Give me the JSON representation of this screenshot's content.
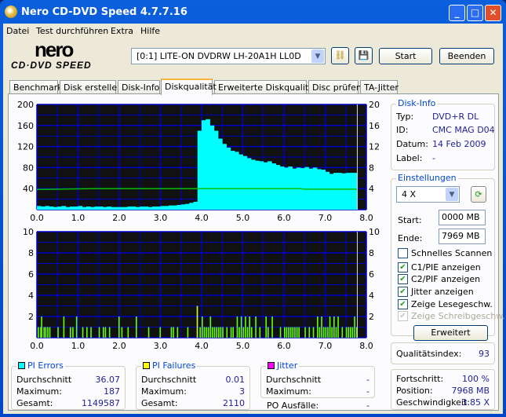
{
  "window": {
    "title": "Nero CD-DVD Speed 4.7.7.16",
    "min": "_",
    "max": "□",
    "close": "✕"
  },
  "menu": [
    "Datei",
    "Test durchführen",
    "Extra",
    "Hilfe"
  ],
  "logo": {
    "line1": "nero",
    "line2": "CD·DVD SPEED"
  },
  "toolbar": {
    "drive": "[0:1]   LITE-ON DVDRW LH-20A1H LL0D",
    "start": "Start",
    "exit": "Beenden"
  },
  "tabs": [
    "Benchmark",
    "Disk erstellen",
    "Disk-Info",
    "Diskqualität",
    "Erweiterte Diskqualität",
    "Disc prüfen",
    "TA-Jitter"
  ],
  "disk_info": {
    "title": "Disk-Info",
    "type_label": "Typ:",
    "type": "DVD+R DL",
    "id_label": "ID:",
    "id": "CMC MAG D04",
    "date_label": "Datum:",
    "date": "14 Feb 2009",
    "label_label": "Label:",
    "label": "-"
  },
  "settings": {
    "title": "Einstellungen",
    "speed": "4 X",
    "start_label": "Start:",
    "start": "0000 MB",
    "end_label": "Ende:",
    "end": "7969 MB",
    "checks": [
      {
        "label": "Schnelles Scannen",
        "checked": false,
        "enabled": true
      },
      {
        "label": "C1/PIE anzeigen",
        "checked": true,
        "enabled": true
      },
      {
        "label": "C2/PIF anzeigen",
        "checked": true,
        "enabled": true
      },
      {
        "label": "Jitter anzeigen",
        "checked": true,
        "enabled": true
      },
      {
        "label": "Zeige Lesegeschw.",
        "checked": true,
        "enabled": true
      },
      {
        "label": "Zeige Schreibgeschw.",
        "checked": true,
        "enabled": false
      }
    ],
    "advanced": "Erweitert"
  },
  "quality": {
    "label": "Qualitätsindex:",
    "value": "93"
  },
  "progress": {
    "progress_label": "Fortschritt:",
    "progress": "100 %",
    "position_label": "Position:",
    "position": "7968 MB",
    "speed_label": "Geschwindigkeit:",
    "speed": "3.85 X"
  },
  "stats": {
    "pie": {
      "title": "PI Errors",
      "color": "#00ffff",
      "avg_label": "Durchschnitt",
      "avg": "36.07",
      "max_label": "Maximum:",
      "max": "187",
      "total_label": "Gesamt:",
      "total": "1149587"
    },
    "pif": {
      "title": "PI Failures",
      "color": "#ffff00",
      "avg_label": "Durchschnitt",
      "avg": "0.01",
      "max_label": "Maximum:",
      "max": "3",
      "total_label": "Gesamt:",
      "total": "2110"
    },
    "jitter": {
      "title": "Jitter",
      "color": "#ff00ff",
      "avg_label": "Durchschnitt",
      "avg": "-",
      "max_label": "Maximum:",
      "max": "-",
      "po_label": "PO Ausfälle:",
      "po": "-"
    }
  },
  "chart_data": [
    {
      "type": "bar",
      "title": "PI Errors",
      "xlim": [
        0,
        8
      ],
      "ylim": [
        0,
        200
      ],
      "y2lim": [
        0,
        20
      ],
      "xticks": [
        "0.0",
        "1.0",
        "2.0",
        "3.0",
        "4.0",
        "5.0",
        "6.0",
        "7.0",
        "8.0"
      ],
      "yticks": [
        "200",
        "160",
        "120",
        "80",
        "40"
      ],
      "y2ticks": [
        "20",
        "16",
        "12",
        "8",
        "4"
      ],
      "x_step": 0.1,
      "values": [
        7,
        6,
        7,
        6,
        5,
        6,
        7,
        5,
        6,
        6,
        7,
        5,
        6,
        5,
        6,
        6,
        5,
        6,
        5,
        5,
        5,
        5,
        6,
        6,
        5,
        6,
        6,
        5,
        6,
        6,
        7,
        7,
        8,
        8,
        9,
        10,
        11,
        13,
        15,
        150,
        170,
        172,
        160,
        150,
        135,
        125,
        118,
        112,
        110,
        105,
        102,
        98,
        95,
        93,
        92,
        90,
        92,
        88,
        85,
        82,
        80,
        82,
        78,
        80,
        79,
        81,
        78,
        80,
        77,
        76,
        72,
        68,
        70,
        70,
        69,
        70,
        70,
        70
      ],
      "speed_series": [
        [
          0,
          3.85
        ],
        [
          1.3,
          4.0
        ],
        [
          3.9,
          4.0
        ],
        [
          6.4,
          4.0
        ],
        [
          6.5,
          3.9
        ],
        [
          7.78,
          3.9
        ]
      ],
      "end_x": 7.78
    },
    {
      "type": "bar",
      "title": "PI Failures",
      "xlim": [
        0,
        8
      ],
      "ylim": [
        0,
        10
      ],
      "y2lim": [
        0,
        10
      ],
      "xticks": [
        "0.0",
        "1.0",
        "2.0",
        "3.0",
        "4.0",
        "5.0",
        "6.0",
        "7.0",
        "8.0"
      ],
      "yticks": [
        "10",
        "8",
        "6",
        "4",
        "2"
      ],
      "y2ticks": [
        "10",
        "8",
        "6",
        "4",
        "2"
      ],
      "points": [
        [
          0.02,
          1
        ],
        [
          0.08,
          1
        ],
        [
          0.1,
          2
        ],
        [
          0.16,
          1
        ],
        [
          0.2,
          1
        ],
        [
          0.25,
          1
        ],
        [
          0.3,
          1
        ],
        [
          0.5,
          1
        ],
        [
          0.64,
          2
        ],
        [
          0.8,
          1
        ],
        [
          0.86,
          1
        ],
        [
          0.95,
          2
        ],
        [
          1.1,
          1
        ],
        [
          1.2,
          1
        ],
        [
          1.3,
          1
        ],
        [
          1.5,
          1
        ],
        [
          1.6,
          1
        ],
        [
          1.65,
          1
        ],
        [
          1.75,
          1
        ],
        [
          1.98,
          2
        ],
        [
          2.05,
          1
        ],
        [
          2.2,
          1
        ],
        [
          2.4,
          2
        ],
        [
          2.7,
          1
        ],
        [
          2.98,
          1
        ],
        [
          3.25,
          1
        ],
        [
          3.3,
          1
        ],
        [
          3.4,
          1
        ],
        [
          3.65,
          1
        ],
        [
          3.88,
          3
        ],
        [
          3.95,
          1
        ],
        [
          4.0,
          2
        ],
        [
          4.05,
          1
        ],
        [
          4.1,
          1
        ],
        [
          4.15,
          1
        ],
        [
          4.2,
          2
        ],
        [
          4.25,
          1
        ],
        [
          4.3,
          1
        ],
        [
          4.35,
          1
        ],
        [
          4.4,
          1
        ],
        [
          4.45,
          1
        ],
        [
          4.5,
          1
        ],
        [
          4.6,
          1
        ],
        [
          4.7,
          1
        ],
        [
          4.75,
          1
        ],
        [
          4.85,
          2
        ],
        [
          4.9,
          1
        ],
        [
          4.95,
          2
        ],
        [
          5.0,
          1
        ],
        [
          5.05,
          2
        ],
        [
          5.1,
          1
        ],
        [
          5.15,
          2
        ],
        [
          5.2,
          1
        ],
        [
          5.3,
          2
        ],
        [
          5.4,
          1
        ],
        [
          5.55,
          2
        ],
        [
          5.6,
          1
        ],
        [
          5.7,
          2
        ],
        [
          5.9,
          1
        ],
        [
          6.0,
          1
        ],
        [
          6.05,
          1
        ],
        [
          6.1,
          1
        ],
        [
          6.15,
          1
        ],
        [
          6.2,
          1
        ],
        [
          6.25,
          1
        ],
        [
          6.3,
          1
        ],
        [
          6.35,
          1
        ],
        [
          6.5,
          1
        ],
        [
          6.6,
          1
        ],
        [
          6.7,
          1
        ],
        [
          6.8,
          2
        ],
        [
          6.85,
          1
        ],
        [
          6.9,
          2
        ],
        [
          6.95,
          1
        ],
        [
          7.0,
          1
        ],
        [
          7.05,
          1
        ],
        [
          7.1,
          2
        ],
        [
          7.15,
          1
        ],
        [
          7.2,
          2
        ],
        [
          7.25,
          1
        ],
        [
          7.3,
          2
        ],
        [
          7.4,
          1
        ],
        [
          7.5,
          1
        ],
        [
          7.55,
          1
        ],
        [
          7.6,
          1
        ],
        [
          7.65,
          1
        ],
        [
          7.7,
          2
        ],
        [
          7.75,
          1
        ]
      ],
      "end_x": 7.78
    }
  ]
}
